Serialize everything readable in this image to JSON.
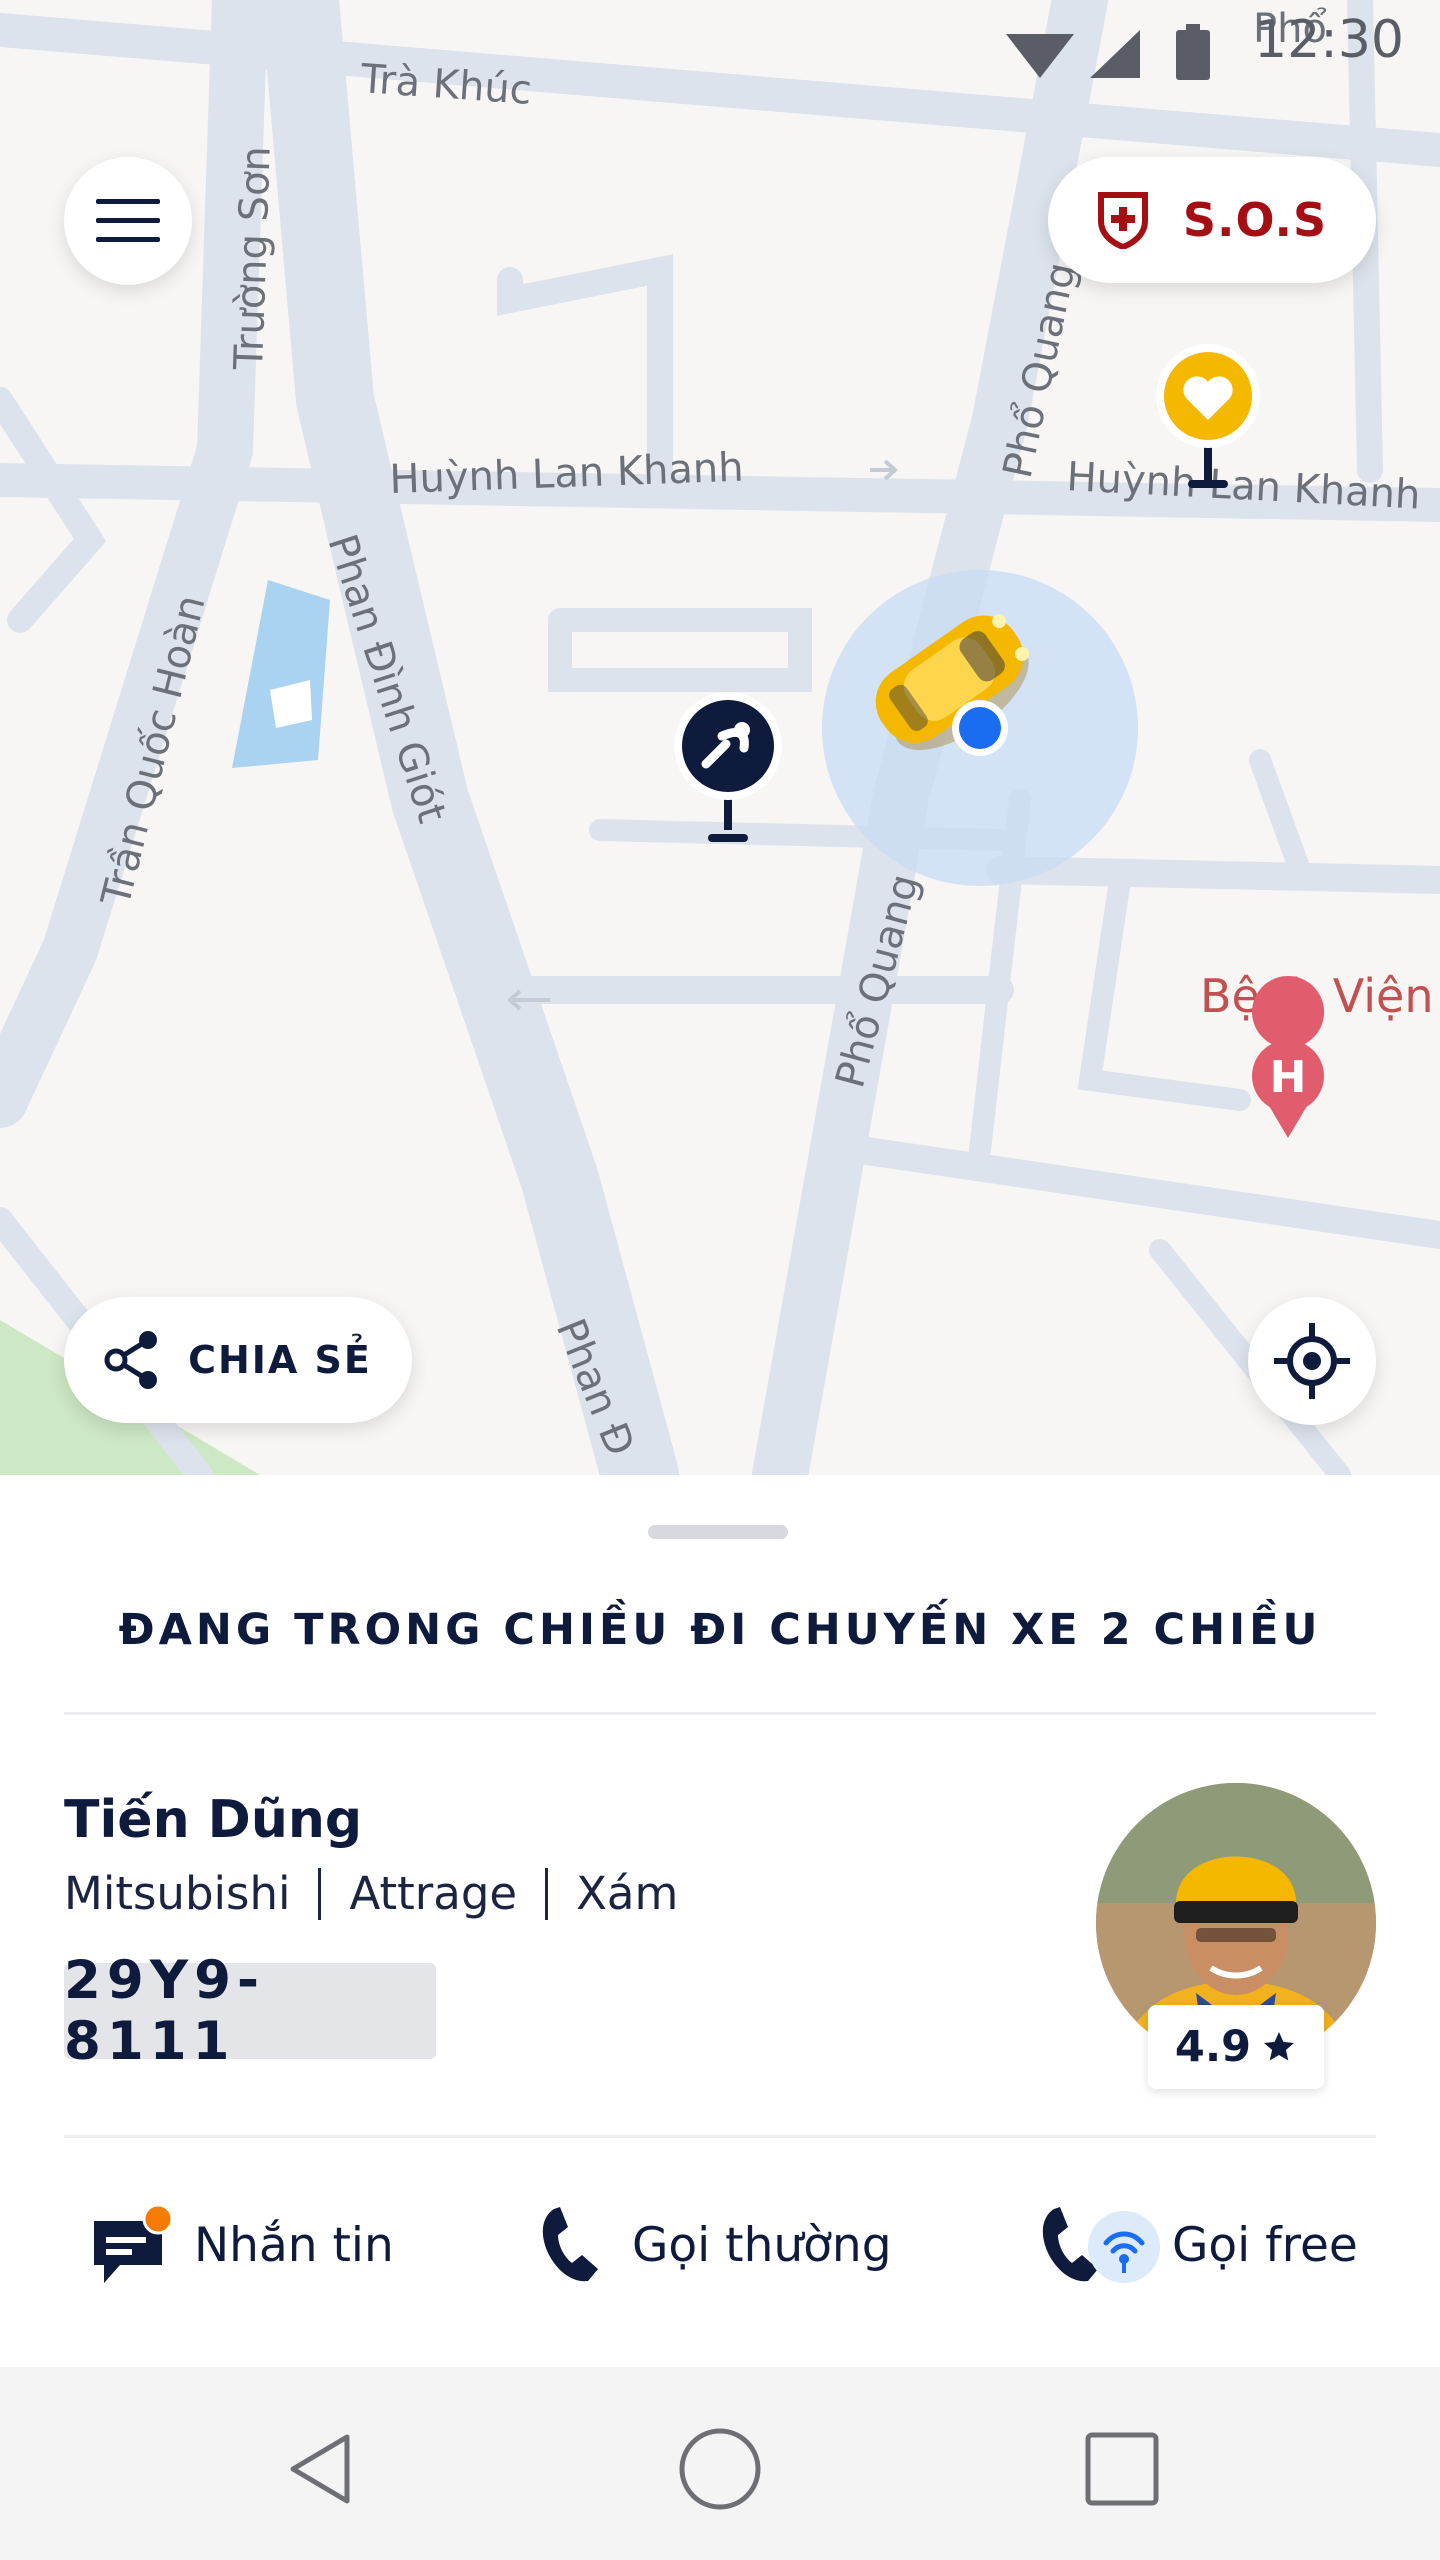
{
  "status_bar": {
    "time": "12:30"
  },
  "map": {
    "streets": {
      "tra_khuc": "Trà Khúc",
      "truong_son": "Trường Sơn",
      "huynh_lan_khanh_1": "Huỳnh Lan Khanh",
      "huynh_lan_khanh_2": "Huỳnh Lan Khanh",
      "pho_quang_1": "Phổ Quang",
      "pho_quang_2": "Phổ Quang",
      "pho_quang_top": "Phổ",
      "tran_quoc_hoan": "Trần Quốc Hoàn",
      "phan_dinh_giot_1": "Phan Đình Giót",
      "phan_dinh_giot_2": "Phan Đ"
    },
    "poi": {
      "hospital_label": "Bệnh Viện",
      "hospital_icon_letter": "H"
    },
    "sos_label": "S.O.S",
    "share_label": "CHIA SẺ"
  },
  "sheet": {
    "trip_status": "ĐANG TRONG CHIỀU ĐI CHUYẾN XE 2 CHIỀU",
    "driver": {
      "name": "Tiến Dũng",
      "brand": "Mitsubishi",
      "model": "Attrage",
      "color": "Xám",
      "plate": "29Y9-8111",
      "rating": "4.9"
    },
    "actions": {
      "message": "Nhắn tin",
      "call": "Gọi thường",
      "free_call": "Gọi free"
    }
  },
  "colors": {
    "navy": "#0f1b3d",
    "sos_red": "#a50f14",
    "taxi_yellow": "#f5b800",
    "location_blue": "#1a6cf0",
    "notification_orange": "#f57c00"
  }
}
